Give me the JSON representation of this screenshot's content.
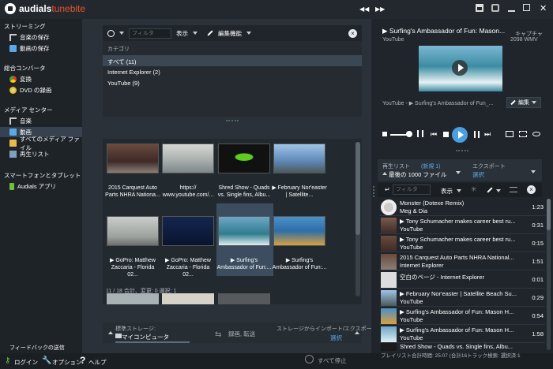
{
  "app": {
    "name_a": "audials",
    "name_b": "tunebite"
  },
  "window_controls": [
    "◀◀",
    "▶▶"
  ],
  "sidebar": {
    "collapse": "«",
    "sections": [
      {
        "title": "ストリーミング",
        "items": [
          "音楽の保存",
          "動画の保存"
        ]
      },
      {
        "title": "総合コンバータ",
        "items": [
          "変換",
          "DVD の録画"
        ]
      },
      {
        "title": "メディア センター",
        "items": [
          "音楽",
          "動画",
          "すべてのメディア ファイル",
          "再生リスト"
        ]
      },
      {
        "title": "スマートフォンとタブレット",
        "items": [
          "Audials アプリ"
        ]
      }
    ],
    "feedback": "フィードバックの送信"
  },
  "toolbar": {
    "filter_placeholder": "フィルタ",
    "view": "表示",
    "edit": "編集機能"
  },
  "categories": {
    "header": "カテゴリ",
    "items": [
      "すべて (11)",
      "Internet Explorer (2)",
      "YouTube (9)"
    ]
  },
  "grid": {
    "items": [
      {
        "caption": "2015 Carquest Auto Parts NHRA Nationa..."
      },
      {
        "caption": "https:// www.youtube.com/..."
      },
      {
        "caption": "Shred Show - Quads vs. Single fins, Albu..."
      },
      {
        "caption": "▶ February Nor'easter | Satellite..."
      },
      {
        "caption": "▶ GoPro: Matthew Zaccaria - Florida 02..."
      },
      {
        "caption": "▶ GoPro: Matthew Zaccaria - Florida 02..."
      },
      {
        "caption": "▶ Surfing's Ambassador of Fun:..."
      },
      {
        "caption": "▶ Surfing's Ambassador of Fun:..."
      }
    ],
    "status": "11 / 18 合計、変更: 0 選択: 1"
  },
  "storage": {
    "label": "標準ストレージ:",
    "value": "マイコンピュータ",
    "transfer": "録画, 転送",
    "import_label": "ストレージからインポート/エクスポート:",
    "import_value": "選択"
  },
  "right": {
    "title": "▶ Surfing's Ambassador of Fun: Mason...",
    "source": "YouTube",
    "capture": "キャプチャ",
    "format": "2098 WMV",
    "caption": "YouTube - ▶ Surfing's Ambassador of Fun_...",
    "edit": "編集"
  },
  "playlist": {
    "label": "再生リスト",
    "new": "(新規 1)",
    "name": "最後の 1000 ファイル",
    "export": "エクスポート",
    "select": "選択",
    "filter_placeholder": "フィルタ",
    "view": "表示",
    "items": [
      {
        "title": "Monster (Dotexe Remix)",
        "sub": "Meg & Dia",
        "dur": "1:23"
      },
      {
        "title": "▶ Tony Schumacher makes career best ru...",
        "sub": "YouTube",
        "dur": "0:31"
      },
      {
        "title": "▶ Tony Schumacher makes career best ru...",
        "sub": "YouTube",
        "dur": "0:15"
      },
      {
        "title": "2015 Carquest Auto Parts NHRA National...",
        "sub": "Internet Explorer",
        "dur": "1:51"
      },
      {
        "title": "空白のページ - Internet Explorer",
        "sub": "",
        "dur": "0:01"
      },
      {
        "title": "▶ February Nor'easter | Satellite Beach Su...",
        "sub": "YouTube",
        "dur": "0:29"
      },
      {
        "title": "▶ Surfing's Ambassador of Fun: Mason H...",
        "sub": "YouTube",
        "dur": "0:54"
      },
      {
        "title": "▶ Surfing's Ambassador of Fun: Mason H...",
        "sub": "YouTube",
        "dur": "1:58"
      },
      {
        "title": "Shred Show - Quads vs. Single fins, Albu...",
        "sub": "",
        "dur": ""
      }
    ],
    "summary": "プレイリスト合計時間: 25:07 (合計16トラック検索: 選択済:1"
  },
  "status": {
    "login": "ログイン",
    "options": "オプション",
    "help": "ヘルプ",
    "stop_all": "すべて停止"
  }
}
